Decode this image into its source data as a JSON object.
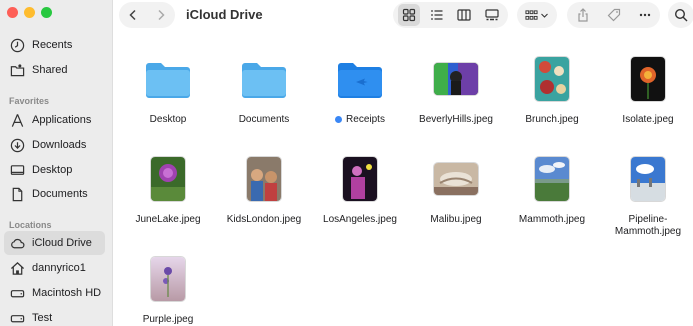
{
  "window": {
    "title": "iCloud Drive"
  },
  "sidebar": {
    "top": [
      {
        "label": "Recents",
        "icon": "clock-icon"
      },
      {
        "label": "Shared",
        "icon": "shared-folder-icon"
      }
    ],
    "favorites_heading": "Favorites",
    "favorites": [
      {
        "label": "Applications",
        "icon": "applications-icon"
      },
      {
        "label": "Downloads",
        "icon": "downloads-icon"
      },
      {
        "label": "Desktop",
        "icon": "desktop-icon"
      },
      {
        "label": "Documents",
        "icon": "document-icon"
      }
    ],
    "locations_heading": "Locations",
    "locations": [
      {
        "label": "iCloud Drive",
        "icon": "cloud-icon",
        "selected": true
      },
      {
        "label": "dannyrico1",
        "icon": "home-icon"
      },
      {
        "label": "Macintosh HD",
        "icon": "drive-icon"
      },
      {
        "label": "Test",
        "icon": "drive-icon"
      }
    ]
  },
  "files": [
    {
      "name": "Desktop",
      "kind": "folder"
    },
    {
      "name": "Documents",
      "kind": "folder"
    },
    {
      "name": "Receipts",
      "kind": "folder",
      "tag_color": "#3a87f5"
    },
    {
      "name": "BeverlyHills.jpeg",
      "kind": "image"
    },
    {
      "name": "Brunch.jpeg",
      "kind": "image"
    },
    {
      "name": "Isolate.jpeg",
      "kind": "image"
    },
    {
      "name": "JuneLake.jpeg",
      "kind": "image"
    },
    {
      "name": "KidsLondon.jpeg",
      "kind": "image"
    },
    {
      "name": "LosAngeles.jpeg",
      "kind": "image"
    },
    {
      "name": "Malibu.jpeg",
      "kind": "image"
    },
    {
      "name": "Mammoth.jpeg",
      "kind": "image"
    },
    {
      "name": "Pipeline-Mammoth.jpeg",
      "kind": "image"
    },
    {
      "name": "Purple.jpeg",
      "kind": "image"
    }
  ],
  "colors": {
    "folder": "#5bb6ee",
    "accent": "#3a87f5"
  }
}
